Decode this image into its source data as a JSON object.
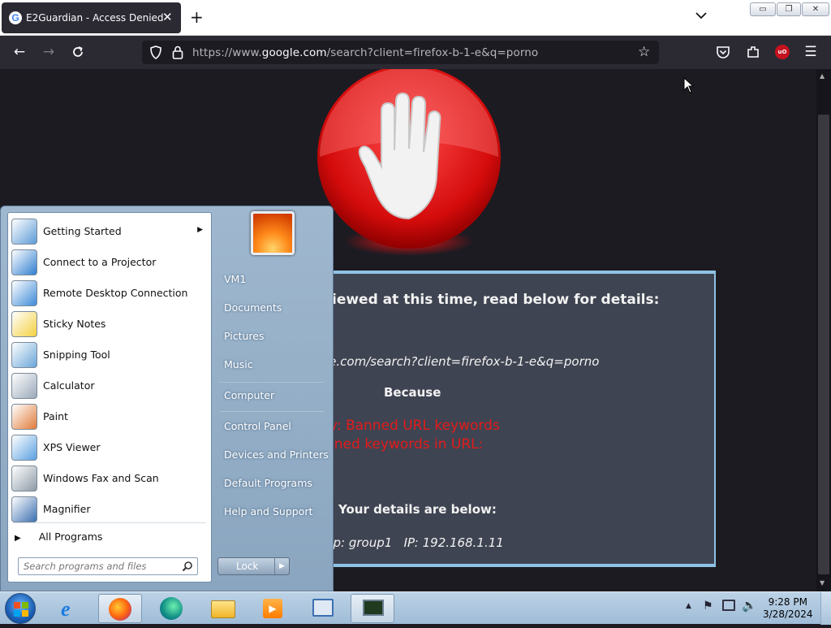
{
  "browser": {
    "tab_title": "E2Guardian - Access Denied",
    "tab_favicon_letter": "G",
    "url": "https://www.google.com/search?client=firefox-b-1-e&q=porno",
    "url_prefix": "https://www.",
    "url_domain": "google.com",
    "url_rest": "/search?client=firefox-b-1-e&q=porno",
    "window_buttons": [
      "minimize",
      "restore",
      "close"
    ]
  },
  "page": {
    "heading_fragment": "iewed at this time, read below for details:",
    "url_fragment": "le.com/search?client=firefox-b-1-e&q=porno",
    "because": "Because",
    "reason_line1": "ry: Banned URL keywords",
    "reason_line2": "nned keywords in URL:",
    "details_heading": "Your details are below:",
    "details_line": "up: group1   IP: 192.168.1.11",
    "colors": {
      "panel": "#3f4452",
      "border": "#8fc3e6",
      "reason": "#e31b1b"
    }
  },
  "start_menu": {
    "programs": [
      {
        "label": "Getting Started",
        "icon": "getting-started-icon",
        "submenu": true
      },
      {
        "label": "Connect to a Projector",
        "icon": "projector-icon"
      },
      {
        "label": "Remote Desktop Connection",
        "icon": "remote-desktop-icon"
      },
      {
        "label": "Sticky Notes",
        "icon": "sticky-notes-icon"
      },
      {
        "label": "Snipping Tool",
        "icon": "snipping-tool-icon"
      },
      {
        "label": "Calculator",
        "icon": "calculator-icon"
      },
      {
        "label": "Paint",
        "icon": "paint-icon"
      },
      {
        "label": "XPS Viewer",
        "icon": "xps-viewer-icon"
      },
      {
        "label": "Windows Fax and Scan",
        "icon": "fax-scan-icon"
      },
      {
        "label": "Magnifier",
        "icon": "magnifier-icon"
      }
    ],
    "all_programs": "All Programs",
    "search_placeholder": "Search programs and files",
    "right_links": [
      "VM1",
      "Documents",
      "Pictures",
      "Music",
      "Computer",
      "Control Panel",
      "Devices and Printers",
      "Default Programs",
      "Help and Support"
    ],
    "lock_label": "Lock"
  },
  "taskbar": {
    "time": "9:28 PM",
    "date": "3/28/2024",
    "apps": [
      "start-orb",
      "internet-explorer-icon",
      "firefox-icon",
      "edge-icon",
      "file-explorer-icon",
      "media-player-icon",
      "control-panel-icon",
      "network-monitor-icon"
    ]
  }
}
